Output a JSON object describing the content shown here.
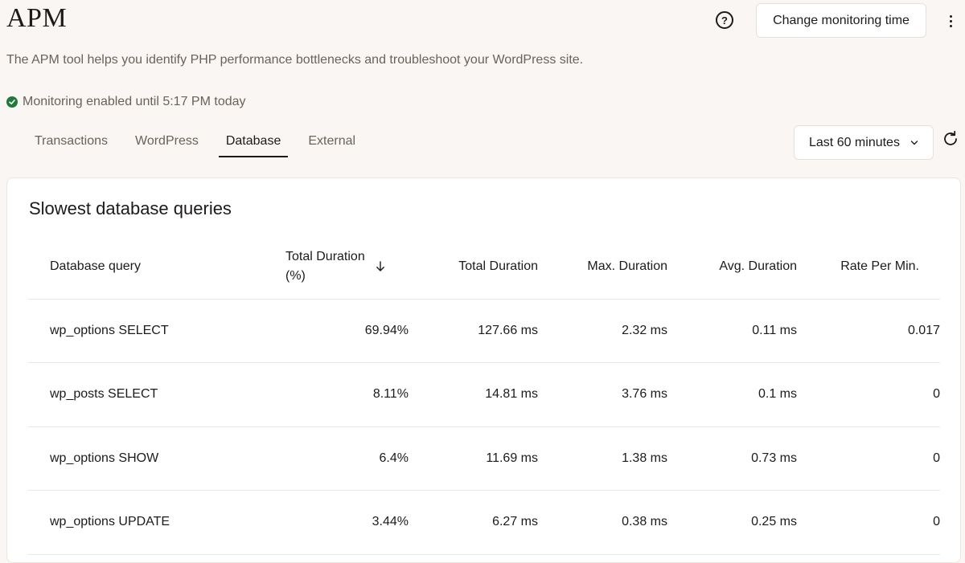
{
  "header": {
    "title": "APM",
    "change_button": "Change monitoring time",
    "description": "The APM tool helps you identify PHP performance bottlenecks and troubleshoot your WordPress site.",
    "status": "Monitoring enabled until 5:17 PM today"
  },
  "tabs": [
    {
      "label": "Transactions",
      "active": false
    },
    {
      "label": "WordPress",
      "active": false
    },
    {
      "label": "Database",
      "active": true
    },
    {
      "label": "External",
      "active": false
    }
  ],
  "range": {
    "selected": "Last 60 minutes"
  },
  "card": {
    "title": "Slowest database queries",
    "columns": {
      "query": "Database query",
      "pct": "Total Duration (%)",
      "total": "Total Duration",
      "max": "Max. Duration",
      "avg": "Avg. Duration",
      "rate": "Rate Per Min."
    },
    "rows": [
      {
        "query": "wp_options SELECT",
        "pct": "69.94%",
        "total": "127.66 ms",
        "max": "2.32 ms",
        "avg": "0.11 ms",
        "rate": "0.017"
      },
      {
        "query": "wp_posts SELECT",
        "pct": "8.11%",
        "total": "14.81 ms",
        "max": "3.76 ms",
        "avg": "0.1 ms",
        "rate": "0"
      },
      {
        "query": "wp_options SHOW",
        "pct": "6.4%",
        "total": "11.69 ms",
        "max": "1.38 ms",
        "avg": "0.73 ms",
        "rate": "0"
      },
      {
        "query": "wp_options UPDATE",
        "pct": "3.44%",
        "total": "6.27 ms",
        "max": "0.38 ms",
        "avg": "0.25 ms",
        "rate": "0"
      }
    ]
  },
  "colors": {
    "background": "#f9f6f3",
    "text": "#1d1b19",
    "muted": "#6b625a",
    "success": "#1f7a3d",
    "border": "#ece6e0"
  },
  "icons": {
    "help": "question-circle-icon",
    "kebab": "more-vertical-icon",
    "status": "check-circle-icon",
    "sort": "arrow-down-icon",
    "dropdown": "chevron-down-icon",
    "refresh": "refresh-icon"
  }
}
